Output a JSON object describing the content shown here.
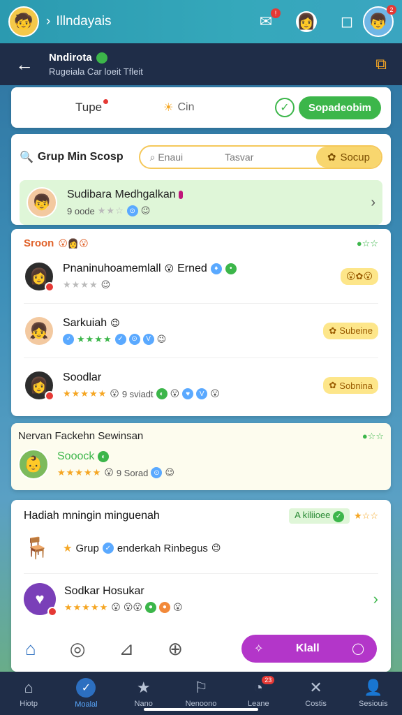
{
  "topbar": {
    "title": "Illndayais",
    "avatar_emoji": "🧒",
    "right_avatar_emoji": "👦",
    "badge1": "!",
    "badge2": "2"
  },
  "subheader": {
    "title": "Nndirota",
    "subtitle": "Rugeiala Car loeit Tfleit"
  },
  "tabs": {
    "tab_a": "Tupe",
    "tab_b": "Cin",
    "green_button": "Sopadeobim"
  },
  "search": {
    "label": "Grup Min Scosp",
    "placeholder1": "Enaui",
    "placeholder2": "Tasvar",
    "button": "Socup"
  },
  "highlight": {
    "name": "Sudibara Medhgalkan",
    "meta": "9 oode",
    "stars": "★★☆"
  },
  "group": {
    "heading": "Sroon",
    "people": [
      {
        "name": "Pnaninuhoamemlall",
        "tag": "Erned",
        "stars": "★★★★",
        "avatar": "👩",
        "button": ""
      },
      {
        "name": "Sarkuiah",
        "tag": "",
        "stars": "★★★★",
        "avatar": "👧",
        "button": "Subeine"
      },
      {
        "name": "Soodlar",
        "tag": "9 sviadt",
        "stars": "★★★★★",
        "avatar": "👩",
        "button": "Sobnina"
      }
    ]
  },
  "feature": {
    "heading": "Nervan Fackehn Sewinsan",
    "name": "Sooock",
    "stars": "★★★★★",
    "meta": "9 Sorad"
  },
  "reward": {
    "heading": "Hadiah mningin minguenah",
    "tag": "A kiliioee",
    "row1": "Grup",
    "row1b": "enderkah Rinbegus",
    "row2": "Sodkar Hosukar"
  },
  "bottom": {
    "purple_button": "Klall"
  },
  "nav": [
    {
      "label": "Hiotp",
      "icon": "⌂"
    },
    {
      "label": "Moalal",
      "icon": "✓"
    },
    {
      "label": "Nano",
      "icon": "★"
    },
    {
      "label": "Nenoono",
      "icon": "⚐"
    },
    {
      "label": "Leane",
      "icon": "◔"
    },
    {
      "label": "Costis",
      "icon": "✕"
    },
    {
      "label": "Sesiouis",
      "icon": "👤"
    }
  ]
}
